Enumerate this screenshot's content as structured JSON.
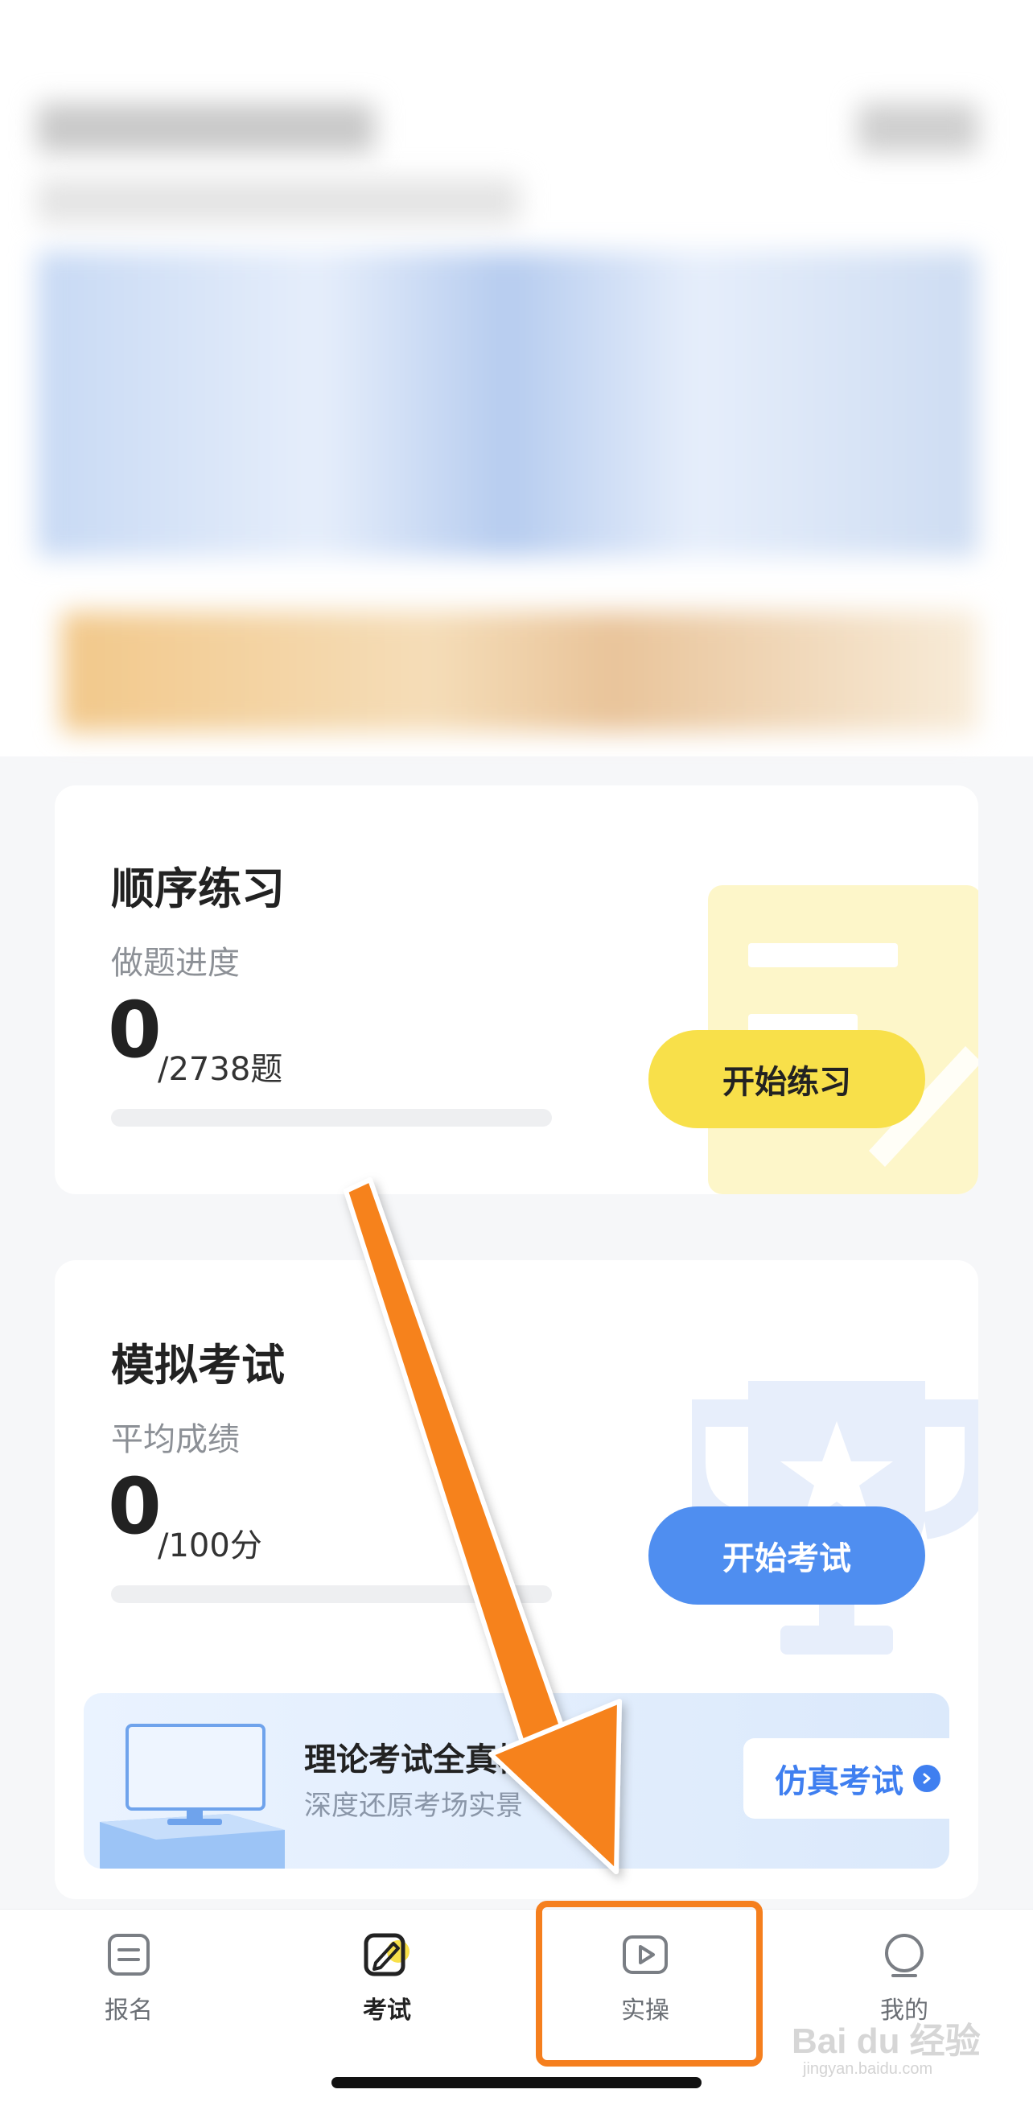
{
  "practice_card": {
    "title": "顺序练习",
    "subtitle": "做题进度",
    "count": "0",
    "total": "/2738题",
    "progress": 0,
    "button": "开始练习"
  },
  "exam_card": {
    "title": "模拟考试",
    "subtitle": "平均成绩",
    "score": "0",
    "total": "/100分",
    "progress": 0,
    "button": "开始考试",
    "banner": {
      "title": "理论考试全真模",
      "subtitle": "深度还原考场实景",
      "button": "仿真考试"
    }
  },
  "tabbar": {
    "items": [
      {
        "label": "报名",
        "icon": "list-icon",
        "active": false
      },
      {
        "label": "考试",
        "icon": "pencil-icon",
        "active": true
      },
      {
        "label": "实操",
        "icon": "play-icon",
        "active": false
      },
      {
        "label": "我的",
        "icon": "person-icon",
        "active": false
      }
    ]
  },
  "watermark": {
    "text": "Bai du 经验",
    "sub": "jingyan.baidu.com"
  },
  "colors": {
    "accent_yellow": "#f8e04a",
    "accent_blue": "#4f8ef0",
    "annotation_orange": "#f57f1e",
    "background": "#f6f7f9"
  }
}
